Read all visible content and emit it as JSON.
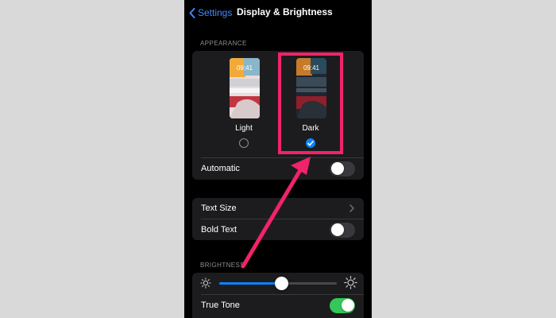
{
  "nav": {
    "back_label": "Settings",
    "title": "Display & Brightness"
  },
  "appearance": {
    "header": "APPEARANCE",
    "light": {
      "label": "Light",
      "time": "09:41",
      "selected": false
    },
    "dark": {
      "label": "Dark",
      "time": "09:41",
      "selected": true
    },
    "automatic": {
      "label": "Automatic",
      "on": false
    }
  },
  "text_group": {
    "text_size": {
      "label": "Text Size"
    },
    "bold_text": {
      "label": "Bold Text",
      "on": false
    }
  },
  "brightness": {
    "header": "BRIGHTNESS",
    "level": 0.53,
    "true_tone": {
      "label": "True Tone",
      "on": true
    }
  },
  "colors": {
    "accent": "#0a84ff",
    "toggle_on": "#34c759",
    "highlight": "#f0236b",
    "background": "#000000",
    "group_bg": "#1c1c1e"
  },
  "icons": [
    "chevron-left-icon",
    "chevron-right-icon",
    "sun-small-icon",
    "sun-large-icon",
    "checkmark-icon"
  ]
}
